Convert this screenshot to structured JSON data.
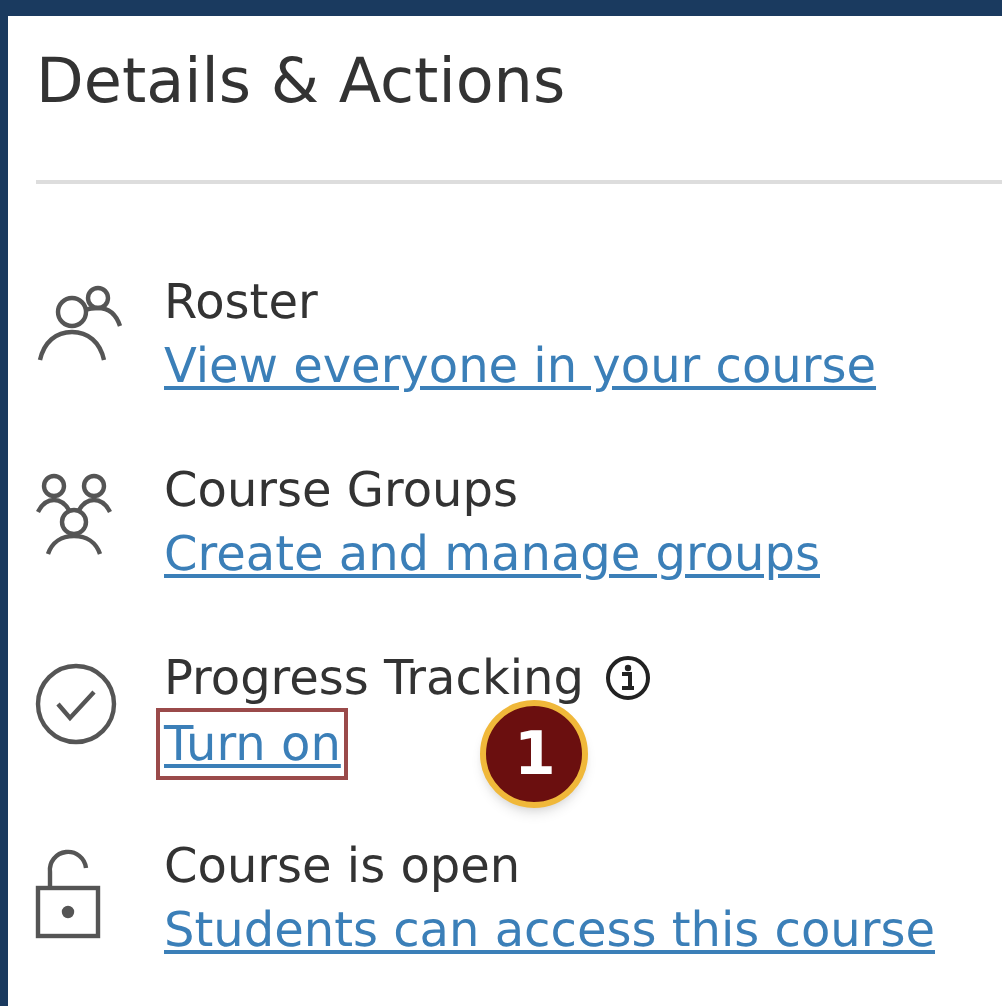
{
  "panel": {
    "title": "Details & Actions"
  },
  "items": [
    {
      "kind": "roster",
      "label": "Roster",
      "link": "View everyone in your course",
      "info": false,
      "highlighted": false
    },
    {
      "kind": "groups",
      "label": "Course Groups",
      "link": "Create and manage groups",
      "info": false,
      "highlighted": false
    },
    {
      "kind": "progress",
      "label": "Progress Tracking",
      "link": "Turn on",
      "info": true,
      "highlighted": true,
      "callout": "1"
    },
    {
      "kind": "lock",
      "label": "Course is open",
      "link": "Students can access this course",
      "info": false,
      "highlighted": false
    }
  ]
}
